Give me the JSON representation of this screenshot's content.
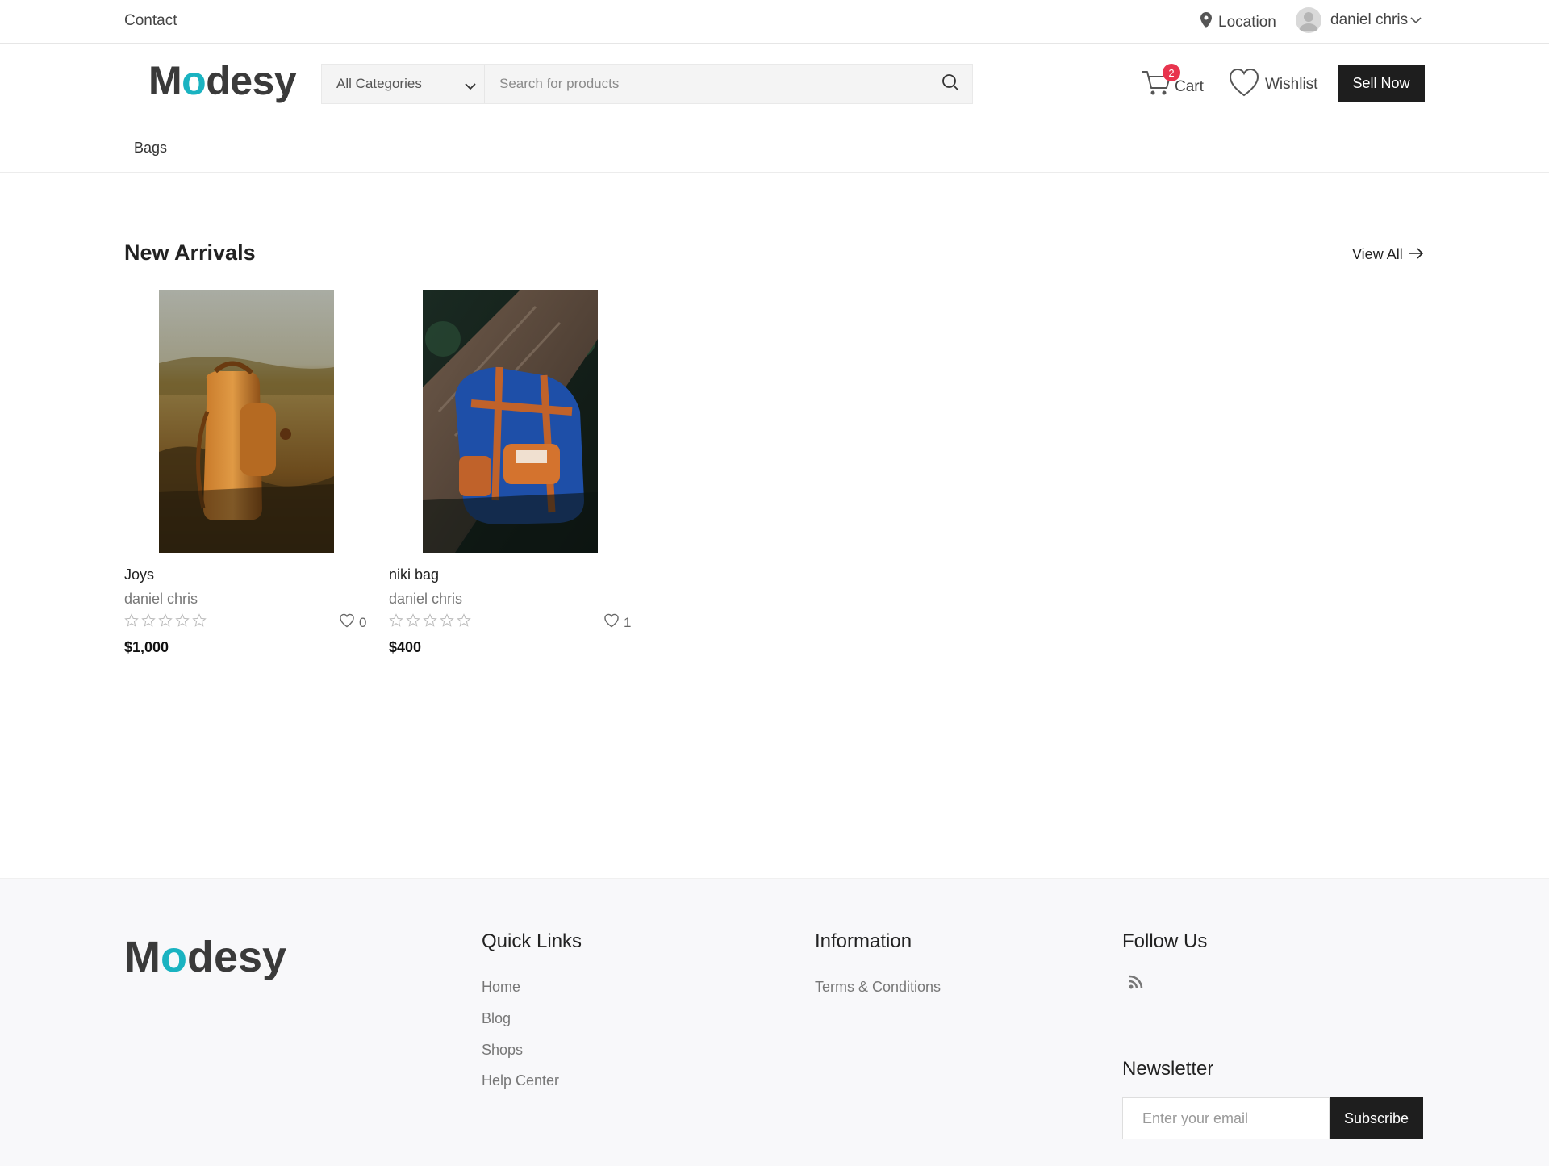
{
  "topbar": {
    "contact": "Contact",
    "location": "Location",
    "user_name": "daniel chris"
  },
  "header": {
    "logo_prefix": "M",
    "logo_accent": "o",
    "logo_suffix": "desy",
    "category_selected": "All Categories",
    "search_placeholder": "Search for products",
    "cart_label": "Cart",
    "cart_count": "2",
    "wishlist_label": "Wishlist",
    "sell_now": "Sell Now"
  },
  "nav": {
    "items": [
      {
        "label": "Bags"
      }
    ]
  },
  "main": {
    "section_title": "New Arrivals",
    "view_all": "View All",
    "products": [
      {
        "name": "Joys",
        "seller": "daniel chris",
        "rating": 0,
        "likes": "0",
        "price": "$1,000",
        "image": "brown-leather-backpack-in-grass"
      },
      {
        "name": "niki bag",
        "seller": "daniel chris",
        "rating": 0,
        "likes": "1",
        "price": "$400",
        "image": "blue-backpack-on-log"
      }
    ]
  },
  "footer": {
    "logo_prefix": "M",
    "logo_accent": "o",
    "logo_suffix": "desy",
    "quick_links_title": "Quick Links",
    "quick_links": [
      {
        "label": "Home"
      },
      {
        "label": "Blog"
      },
      {
        "label": "Shops"
      },
      {
        "label": "Help Center"
      }
    ],
    "information_title": "Information",
    "information_links": [
      {
        "label": "Terms & Conditions"
      }
    ],
    "follow_title": "Follow Us",
    "follow_icons": [
      "rss-icon"
    ],
    "newsletter_title": "Newsletter",
    "email_placeholder": "Enter your email",
    "subscribe": "Subscribe"
  },
  "colors": {
    "accent": "#1ab3c1",
    "badge": "#e8344e",
    "dark_button": "#1e1e1e",
    "footer_bg": "#f8f8fa"
  }
}
